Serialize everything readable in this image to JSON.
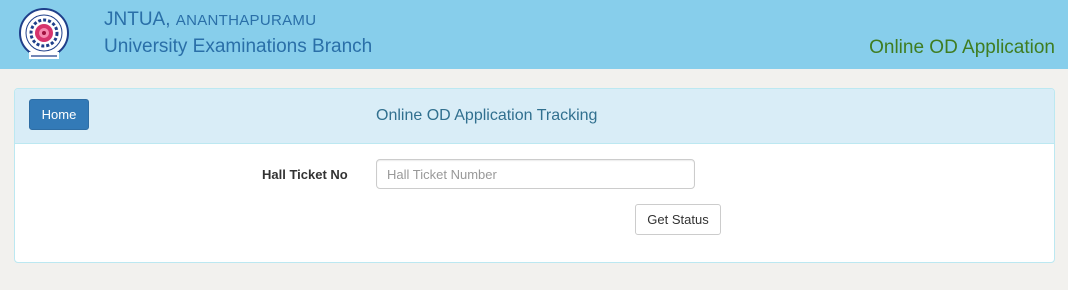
{
  "header": {
    "org_name": "JNTUA,",
    "org_location": "ANANTHAPURAMU",
    "department": "University Examinations Branch",
    "app_title": "Online OD Application",
    "logo_icon": "university-seal-icon",
    "logo_motto": "विद्या अमृतं अश्नुते",
    "logo_ring_text": "JAWAHARLAL NEHRU TECHNOLOGICAL UNIVERSITY"
  },
  "panel": {
    "home_label": "Home",
    "title": "Online OD Application Tracking",
    "hall_ticket_label": "Hall Ticket No",
    "hall_ticket_value": "",
    "hall_ticket_placeholder": "Hall Ticket Number",
    "submit_label": "Get Status"
  },
  "colors": {
    "header_bg": "#87ceeb",
    "org_text": "#2a6fa8",
    "app_title_text": "#3f7d21",
    "panel_heading_bg": "#d9edf7",
    "primary_button": "#337ab7"
  }
}
